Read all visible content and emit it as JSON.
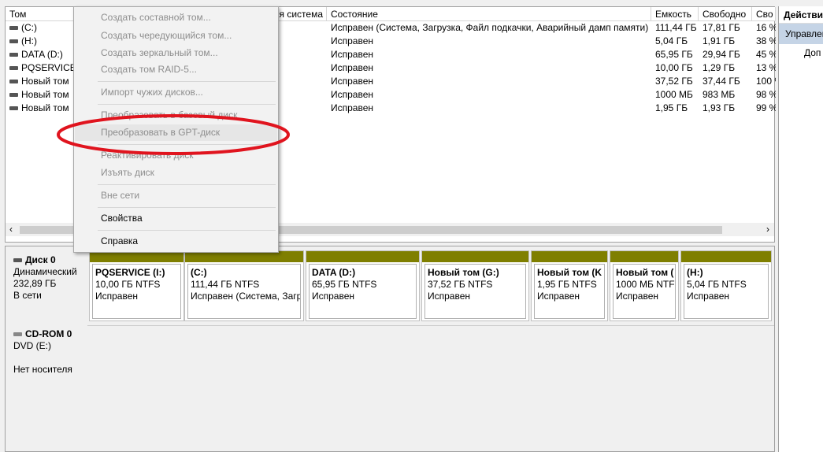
{
  "list": {
    "columns": [
      "Том",
      "я система",
      "Состояние",
      "Емкость",
      "Свободно",
      "Сво"
    ],
    "rows": [
      {
        "name": "(C:)",
        "status": "Исправен (Система, Загрузка, Файл подкачки, Аварийный дамп памяти)",
        "capacity": "111,44 ГБ",
        "free": "17,81 ГБ",
        "pct": "16 %"
      },
      {
        "name": "(H:)",
        "status": "Исправен",
        "capacity": "5,04 ГБ",
        "free": "1,91 ГБ",
        "pct": "38 %"
      },
      {
        "name": "DATA (D:)",
        "status": "Исправен",
        "capacity": "65,95 ГБ",
        "free": "29,94 ГБ",
        "pct": "45 %"
      },
      {
        "name": "PQSERVICE (",
        "status": "Исправен",
        "capacity": "10,00 ГБ",
        "free": "1,29 ГБ",
        "pct": "13 %"
      },
      {
        "name": "Новый том",
        "status": "Исправен",
        "capacity": "37,52 ГБ",
        "free": "37,44 ГБ",
        "pct": "100 %"
      },
      {
        "name": "Новый том",
        "status": "Исправен",
        "capacity": "1000 МБ",
        "free": "983 МБ",
        "pct": "98 %"
      },
      {
        "name": "Новый том",
        "status": "Исправен",
        "capacity": "1,95 ГБ",
        "free": "1,93 ГБ",
        "pct": "99 %"
      }
    ],
    "scroll_left": "‹",
    "scroll_right": "›"
  },
  "actions": {
    "title": "Действия",
    "item": "Управление",
    "sub": "Доп"
  },
  "disks": [
    {
      "name": "Диск 0",
      "type": "Динамический",
      "size": "232,89 ГБ",
      "state": "В сети"
    },
    {
      "name": "CD-ROM 0",
      "type": "DVD (E:)",
      "size": "",
      "state": "Нет носителя"
    }
  ],
  "partitions": [
    {
      "name": "PQSERVICE  (I:)",
      "size": "10,00 ГБ NTFS",
      "status": "Исправен"
    },
    {
      "name": " (C:)",
      "size": "111,44 ГБ NTFS",
      "status": "Исправен (Система, Загр"
    },
    {
      "name": "DATA  (D:)",
      "size": "65,95 ГБ NTFS",
      "status": "Исправен"
    },
    {
      "name": "Новый том  (G:)",
      "size": "37,52 ГБ NTFS",
      "status": "Исправен"
    },
    {
      "name": "Новый том  (K",
      "size": "1,95 ГБ NTFS",
      "status": "Исправен"
    },
    {
      "name": "Новый том  (",
      "size": "1000 МБ NTFS",
      "status": "Исправен"
    },
    {
      "name": " (H:)",
      "size": "5,04 ГБ NTFS",
      "status": "Исправен"
    }
  ],
  "menu": {
    "items": [
      "Создать составной том...",
      "Создать чередующийся том...",
      "Создать зеркальный том...",
      "Создать том RAID-5...",
      "Импорт чужих дисков...",
      "Преобразовать в базовый диск",
      "Преобразовать в GPT-диск",
      "Реактивировать диск",
      "Изъять диск",
      "Вне сети",
      "Свойства",
      "Справка"
    ]
  },
  "annotation_color": "#e0141e",
  "colors": {
    "partition_bar": "#7f7f00"
  }
}
